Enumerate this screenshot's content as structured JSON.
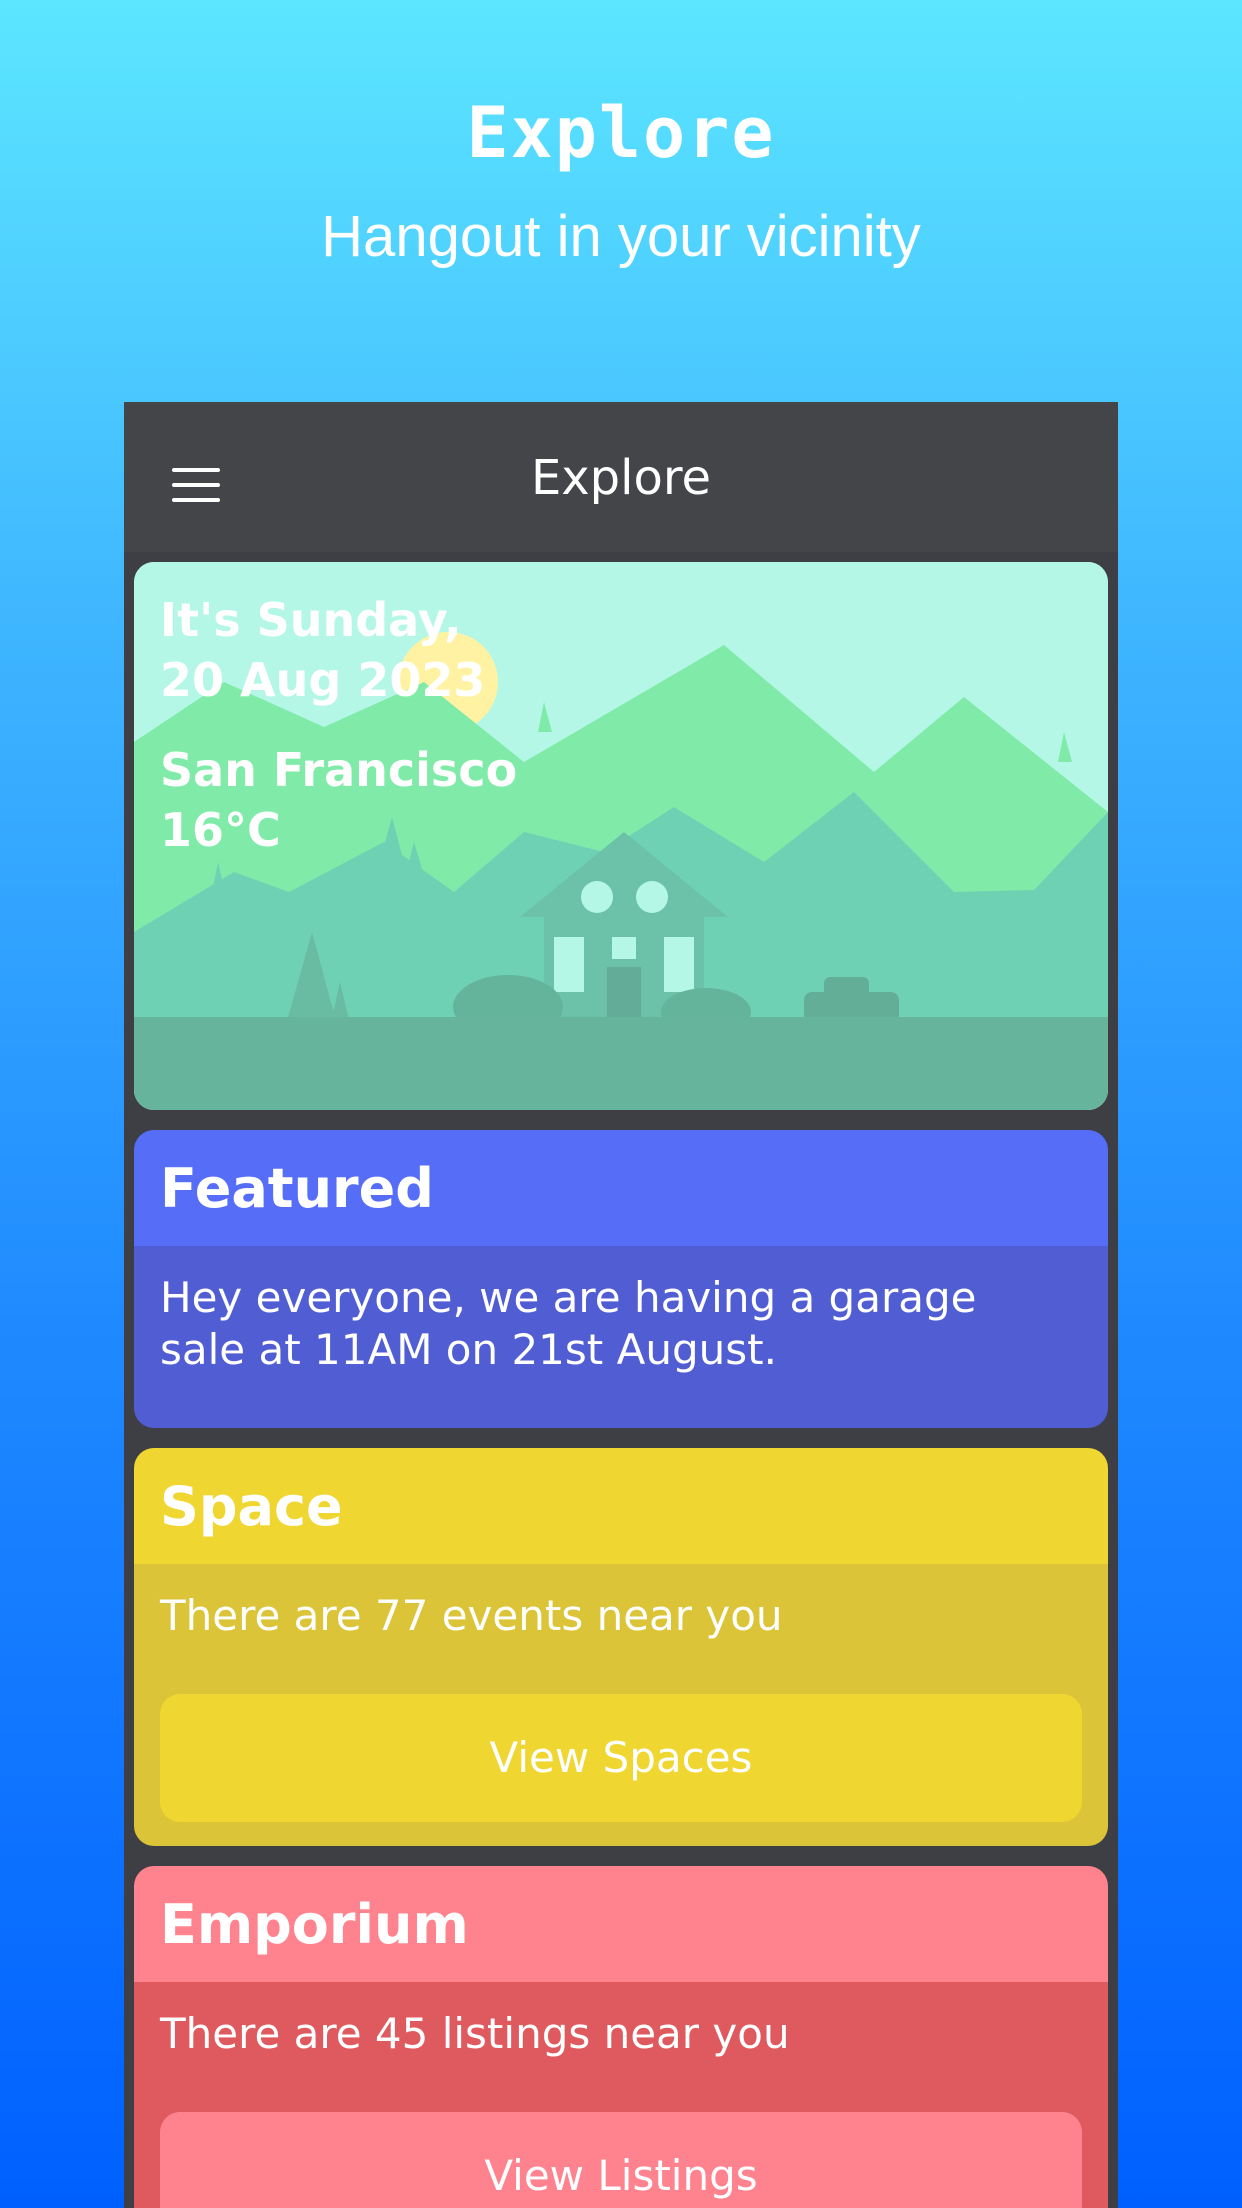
{
  "hero": {
    "title": "Explore",
    "subtitle": "Hangout in your vicinity"
  },
  "app_bar": {
    "title": "Explore",
    "menu_icon": "hamburger-menu-icon"
  },
  "weather": {
    "day_line": "It's Sunday,",
    "date_line": "20 Aug 2023",
    "city": "San Francisco",
    "temperature": "16°C"
  },
  "featured": {
    "title": "Featured",
    "message": "Hey everyone, we are having a garage sale at 11AM on 21st August.",
    "colors": {
      "header": "#566ef7",
      "body": "#505dd3"
    }
  },
  "space": {
    "title": "Space",
    "message": "There are 77 events near you",
    "button_label": "View Spaces",
    "colors": {
      "header": "#f0d631",
      "body": "#dbc437",
      "button": "#f0d631"
    }
  },
  "emporium": {
    "title": "Emporium",
    "message": "There are 45 listings near you",
    "button_label": "View Listings",
    "colors": {
      "header": "#fe838e",
      "body": "#df5a5e",
      "button": "#fe838e"
    }
  }
}
